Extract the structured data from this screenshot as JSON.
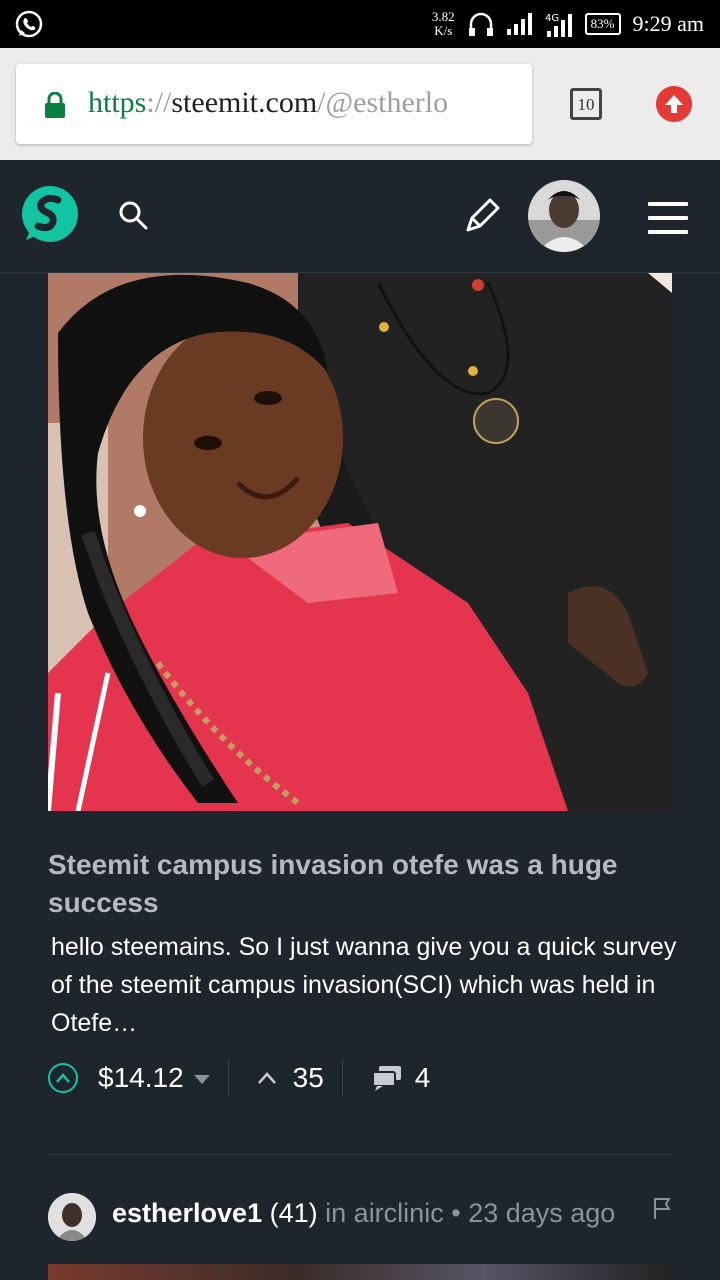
{
  "status_bar": {
    "speed_value": "3.82",
    "speed_unit": "K/s",
    "battery": "83%",
    "time": "9:29 am",
    "icons": [
      "whatsapp-icon",
      "headphones-icon",
      "signal-icon",
      "signal-icon",
      "battery-icon"
    ]
  },
  "browser": {
    "url_scheme": "https",
    "url_sep": "://",
    "url_host": "steemit.com",
    "url_path": "/@estherlo",
    "tab_count": "10",
    "colors": {
      "secure": "#0b8043",
      "upload": "#e53935"
    }
  },
  "header": {
    "icons": [
      "steemit-logo",
      "search-icon",
      "pen-icon",
      "avatar",
      "menu-icon"
    ],
    "accent": "#13c4a3"
  },
  "post": {
    "title": "Steemit campus invasion otefe was a huge success",
    "excerpt": "hello steemains. So I just wanna give you a quick survey of the steemit campus invasion(SCI) which was held in Otefe…",
    "payout": "$14.12",
    "votes": "35",
    "comments": "4"
  },
  "next_post": {
    "author": "estherlove1",
    "reputation": "(41)",
    "in_label": "in",
    "community": "airclinic",
    "separator": "•",
    "age": "23 days ago"
  }
}
